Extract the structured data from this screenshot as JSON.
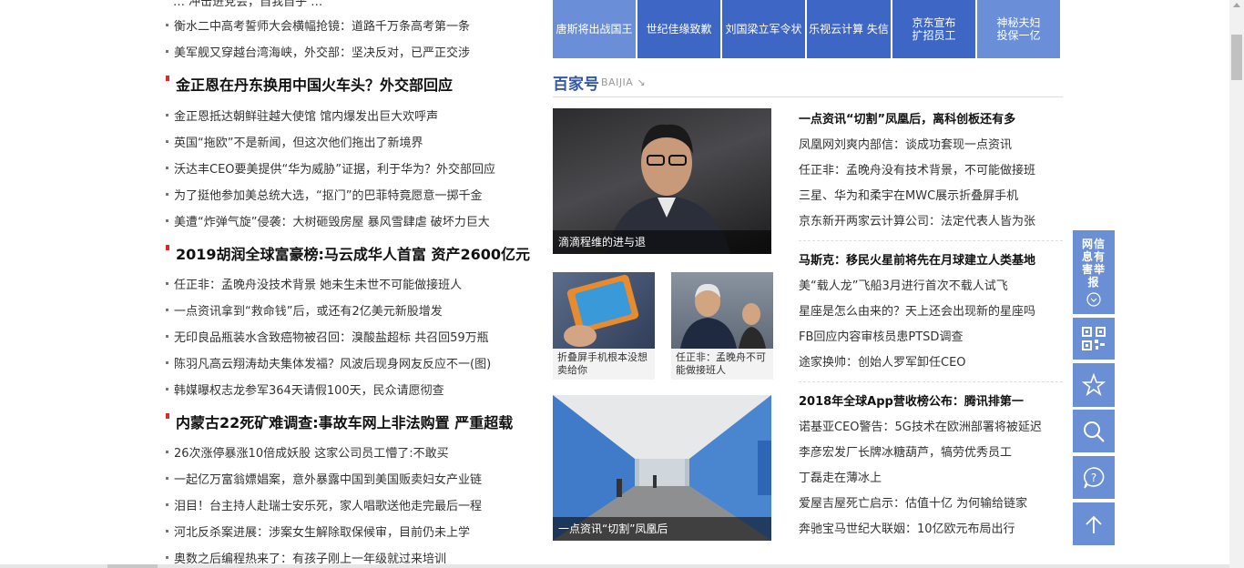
{
  "left_news": {
    "top_cut": "… 冲击进党会，自我自乎 …",
    "items_a": [
      "衡水二中高考誓师大会横幅抢镜：道路千万条高考第一条",
      "美军舰又穿越台湾海峡，外交部：坚决反对，已严正交涉"
    ],
    "lead1": "金正恩在丹东换用中国火车头？外交部回应",
    "items_b": [
      "金正恩抵达朝鲜驻越大使馆 馆内爆发出巨大欢呼声",
      "英国“拖欧”不是新闻，但这次他们拖出了新境界",
      "沃达丰CEO要美提供“华为威胁”证据，利于华为？外交部回应",
      "为了挺他参加美总统大选，“抠门”的巴菲特竟愿意一掷千金",
      "美遭“炸弹气旋”侵袭：大树砸毁房屋 暴风雪肆虐 破坏力巨大"
    ],
    "lead2": "2019胡润全球富豪榜:马云成华人首富 资产2600亿元",
    "items_c": [
      "任正非：孟晚舟没技术背景 她未生未世不可能做接班人",
      "一点资讯拿到“救命钱”后，或还有2亿美元新股增发",
      "无印良品瓶装水含致癌物被召回：溴酸盐超标 共召回59万瓶",
      "陈羽凡高云翔涛劫夫集体发福？风波后现身网友反应不一(图)",
      "韩媒曝权志龙参军364天请假100天，民众请愿彻查"
    ],
    "lead3": "内蒙古22死矿难调查:事故车网上非法购置 严重超载",
    "items_d": [
      "26次涨停暴涨10倍成妖股 这家公司员工懵了:不敢买",
      "一起亿万富翁嫖娼案，意外暴露中国到美国贩卖妇女产业链",
      "泪目！台主持人赴瑞士安乐死，家人唱歌送他走完最后一程",
      "河北反杀案进展：涉案女生解除取保候审，目前仍未上学",
      "奥数之后编程热来了：有孩子刚上一年级就过来培训"
    ]
  },
  "top_tiles": [
    {
      "label": "唐斯将出战国王"
    },
    {
      "label": "世纪佳缘致歉"
    },
    {
      "label": "刘国梁立军令状"
    },
    {
      "label": "乐视云计算 失信"
    },
    {
      "label": "京东宣布\n扩招员工"
    },
    {
      "label": "神秘夫妇\n投保一亿"
    }
  ],
  "baijia": {
    "title": "百家号",
    "subtitle": "BAIJIA",
    "main_photo_caption": "滴滴程维的进与退",
    "small1_caption": "折叠屏手机根本没想卖给你",
    "small2_caption": "任正非：孟晚舟不可能做接班人",
    "tunnel_caption": "一点资讯“切割”凤凰后"
  },
  "right_news": {
    "group1_title": "一点资讯“切割”凤凰后，离科创板还有多",
    "group1": [
      "凤凰网刘爽内部信：谈成功套现一点资讯",
      "任正非：孟晚舟没有技术背景，不可能做接班",
      "三星、华为和柔宇在MWC展示折叠屏手机",
      "京东新开两家云计算公司：法定代表人皆为张"
    ],
    "group2_title": "马斯克：移民火星前将先在月球建立人类基地",
    "group2": [
      "美“载人龙”飞船3月进行首次不载人试飞",
      "星座是怎么由来的？天上还会出现新的星座吗",
      "FB回应内容审核员患PTSD调查",
      "途家换帅：创始人罗军卸任CEO"
    ],
    "group3_title": "2018年全球App营收榜公布：腾讯排第一",
    "group3": [
      "诺基亚CEO警告：5G技术在欧洲部署将被延迟",
      "李彦宏发厂长牌冰糖葫芦，犒劳优秀员工",
      "丁磊走在薄冰上",
      "爱屋吉屋死亡启示：估值十亿 为何输给链家",
      "奔驰宝马世纪大联姻：10亿欧元布局出行"
    ]
  },
  "sidebar": {
    "report_label": "网信息有害举报"
  }
}
